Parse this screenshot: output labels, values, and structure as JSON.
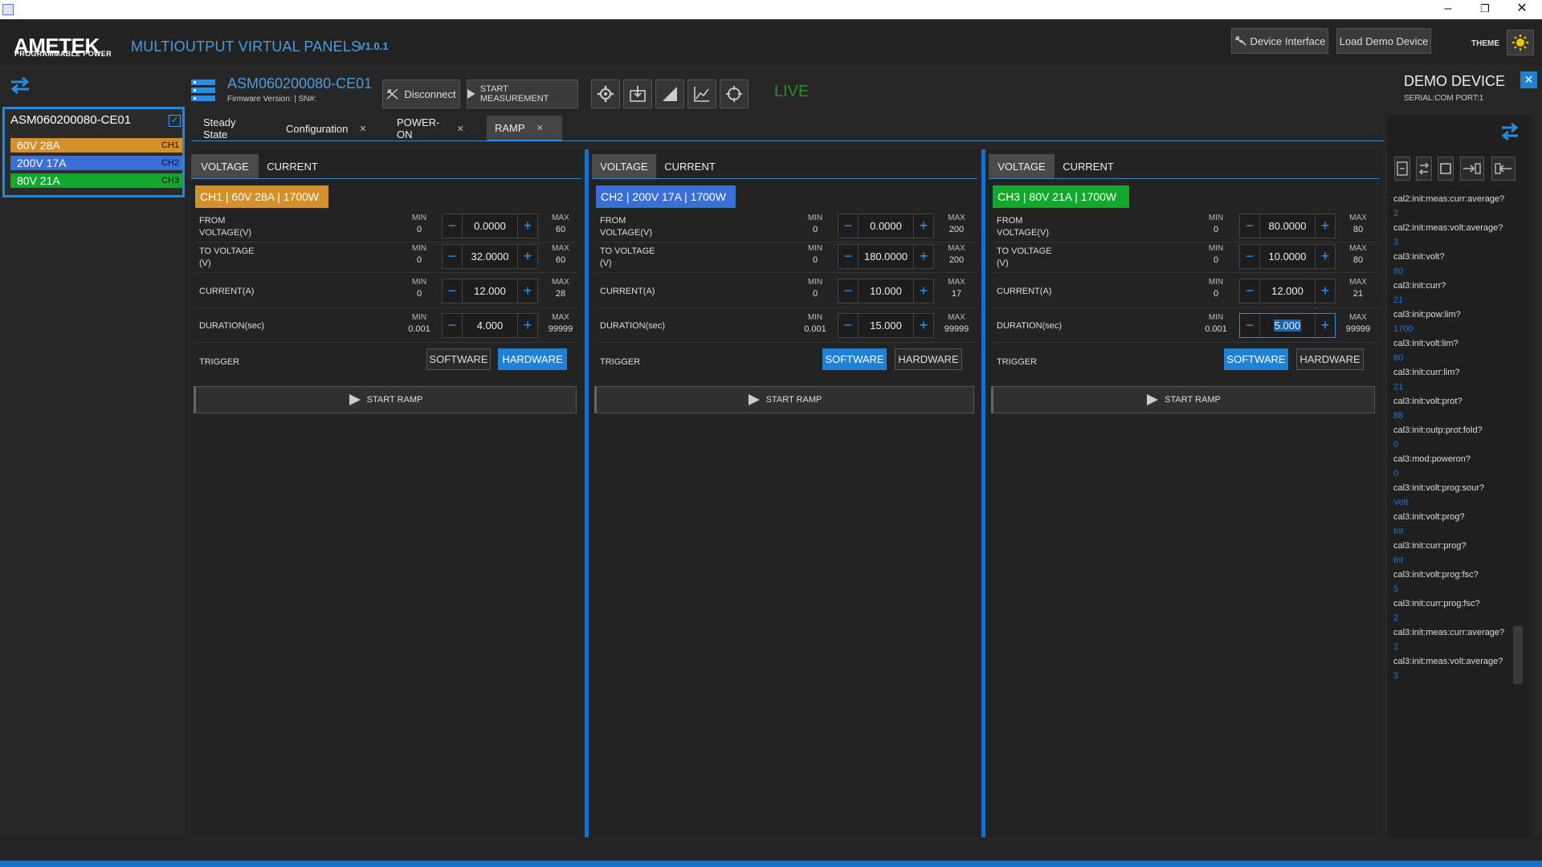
{
  "window": {
    "minimize": "–",
    "maximize": "❐",
    "close": "✕"
  },
  "header": {
    "logo_main": "AMETEK",
    "logo_sub": "PROGRAMMABLE POWER",
    "title": "MULTIOUTPUT VIRTUAL PANELS",
    "version": "V1.0.1",
    "device_interface": "Device Interface",
    "load_demo": "Load Demo Device",
    "theme_label": "THEME"
  },
  "sidebar": {
    "device_name": "ASM060200080-CE01",
    "channels": [
      {
        "label": "60V 28A",
        "ch": "CH1",
        "color": "#d4902a"
      },
      {
        "label": "200V 17A",
        "ch": "CH2",
        "color": "#3b6fd8"
      },
      {
        "label": "80V 21A",
        "ch": "CH3",
        "color": "#12a82e"
      }
    ]
  },
  "devicebar": {
    "title": "ASM060200080-CE01",
    "firmware": "Firmware Version:  |  SN#:",
    "disconnect": "Disconnect",
    "start_measurement": "START MEASUREMENT",
    "status": "LIVE"
  },
  "tabs": [
    {
      "label": "Steady State",
      "closable": false
    },
    {
      "label": "Configuration",
      "closable": true
    },
    {
      "label": "POWER-ON",
      "closable": true
    },
    {
      "label": "RAMP",
      "closable": true,
      "active": true
    }
  ],
  "close_x": "✕",
  "labels": {
    "voltage": "VOLTAGE",
    "current": "CURRENT",
    "from_voltage_1": "FROM",
    "from_voltage_2": "VOLTAGE(V)",
    "to_voltage_1": "TO VOLTAGE",
    "to_voltage_2": "(V)",
    "current_a": "CURRENT(A)",
    "duration": "DURATION(sec)",
    "trigger": "TRIGGER",
    "software": "SOFTWARE",
    "hardware": "HARDWARE",
    "start_ramp": "START RAMP",
    "min": "MIN",
    "max": "MAX",
    "minus": "−",
    "plus": "+"
  },
  "panels": [
    {
      "badge": "CH1 | 60V 28A | 1700W",
      "badge_color": "#d4902a",
      "from_v": {
        "min": "0",
        "value": "0.0000",
        "max": "60"
      },
      "to_v": {
        "min": "0",
        "value": "32.0000",
        "max": "60"
      },
      "current": {
        "min": "0",
        "value": "12.000",
        "max": "28"
      },
      "duration": {
        "min": "0.001",
        "value": "4.000",
        "max": "99999"
      },
      "trigger": "HARDWARE"
    },
    {
      "badge": "CH2 | 200V 17A | 1700W",
      "badge_color": "#3b6fd8",
      "from_v": {
        "min": "0",
        "value": "0.0000",
        "max": "200"
      },
      "to_v": {
        "min": "0",
        "value": "180.0000",
        "max": "200"
      },
      "current": {
        "min": "0",
        "value": "10.000",
        "max": "17"
      },
      "duration": {
        "min": "0.001",
        "value": "15.000",
        "max": "99999"
      },
      "trigger": "SOFTWARE"
    },
    {
      "badge": "CH3 | 80V 21A | 1700W",
      "badge_color": "#12a82e",
      "from_v": {
        "min": "0",
        "value": "80.0000",
        "max": "80"
      },
      "to_v": {
        "min": "0",
        "value": "10.0000",
        "max": "80"
      },
      "current": {
        "min": "0",
        "value": "12.000",
        "max": "21"
      },
      "duration": {
        "min": "0.001",
        "value": "5.000",
        "max": "99999"
      },
      "trigger": "SOFTWARE"
    }
  ],
  "right": {
    "title": "DEMO DEVICE",
    "port": "SERIAL:COM PORT:1",
    "close": "✕",
    "log": [
      {
        "cmd": "cal2:init:meas:curr:average?",
        "val": "2"
      },
      {
        "cmd": "cal2:init:meas:volt:average?",
        "val": "3"
      },
      {
        "cmd": "cal3:init:volt?",
        "val": "80"
      },
      {
        "cmd": "cal3:init:curr?",
        "val": "21"
      },
      {
        "cmd": "cal3:init:pow:lim?",
        "val": "1700"
      },
      {
        "cmd": "cal3:init:volt:lim?",
        "val": "80"
      },
      {
        "cmd": "cal3:init:curr:lim?",
        "val": "21"
      },
      {
        "cmd": "cal3:init:volt:prot?",
        "val": "88"
      },
      {
        "cmd": "cal3:init:outp:prot:fold?",
        "val": "0"
      },
      {
        "cmd": "cal3:mod:poweron?",
        "val": "0"
      },
      {
        "cmd": "cal3:init:volt:prog:sour?",
        "val": "Volt"
      },
      {
        "cmd": "cal3:init:volt:prog?",
        "val": "Int"
      },
      {
        "cmd": "cal3:init:curr:prog?",
        "val": "Int"
      },
      {
        "cmd": "cal3:init:volt:prog:fsc?",
        "val": "5"
      },
      {
        "cmd": "cal3:init:curr:prog:fsc?",
        "val": "2"
      },
      {
        "cmd": "cal3:init:meas:curr:average?",
        "val": "2"
      },
      {
        "cmd": "cal3:init:meas:volt:average?",
        "val": "3"
      }
    ]
  },
  "colors": {
    "accent": "#2a8be0",
    "button_on": "#1f82d6",
    "live": "#1f8f2a"
  }
}
